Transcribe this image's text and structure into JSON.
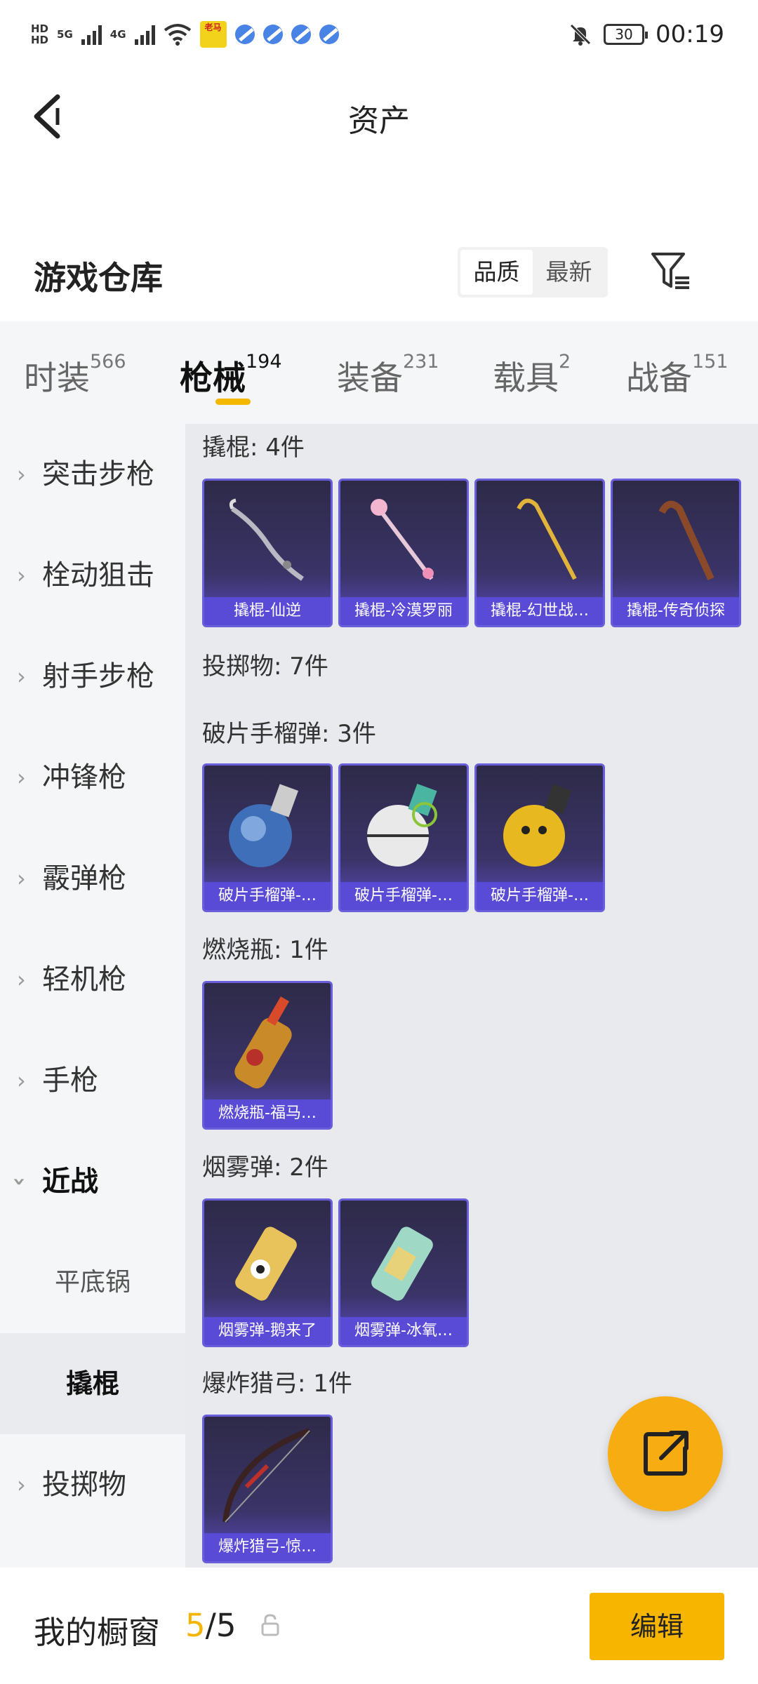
{
  "status_bar": {
    "hd1": "HD",
    "hd2": "HD",
    "net1": "5G",
    "net2": "4G",
    "app_label": "老马",
    "battery": "30",
    "time": "00:19"
  },
  "header": {
    "title": "资产"
  },
  "warehouse": {
    "title": "游戏仓库",
    "sort_options": [
      "品质",
      "最新"
    ]
  },
  "tabs": [
    {
      "label": "时装",
      "count": "566"
    },
    {
      "label": "枪械",
      "count": "194"
    },
    {
      "label": "装备",
      "count": "231"
    },
    {
      "label": "载具",
      "count": "2"
    },
    {
      "label": "战备",
      "count": "151"
    }
  ],
  "sidebar": {
    "items": [
      "突击步枪",
      "栓动狙击",
      "射手步枪",
      "冲锋枪",
      "霰弹枪",
      "轻机枪",
      "手枪",
      "近战",
      "投掷物"
    ],
    "sub_items": [
      "平底锅",
      "撬棍"
    ]
  },
  "sections": {
    "crowbar": {
      "title": "撬棍: 4件",
      "items": [
        "撬棍-仙逆",
        "撬棍-冷漠罗丽",
        "撬棍-幻世战…",
        "撬棍-传奇侦探"
      ]
    },
    "throwables": {
      "title": "投掷物: 7件"
    },
    "frag": {
      "title": "破片手榴弹: 3件",
      "items": [
        "破片手榴弹-…",
        "破片手榴弹-…",
        "破片手榴弹-…"
      ]
    },
    "molotov": {
      "title": "燃烧瓶: 1件",
      "items": [
        "燃烧瓶-福马…"
      ]
    },
    "smoke": {
      "title": "烟雾弹: 2件",
      "items": [
        "烟雾弹-鹅来了",
        "烟雾弹-冰氧…"
      ]
    },
    "bow": {
      "title": "爆炸猎弓: 1件",
      "items": [
        "爆炸猎弓-惊…"
      ]
    }
  },
  "bottom_bar": {
    "label": "我的橱窗",
    "count_current": "5",
    "count_sep": "/",
    "count_total": "5",
    "edit_label": "编辑"
  },
  "colors": {
    "accent": "#f7b500",
    "card_bg": "#3a3468",
    "card_caption": "#5a4bd6"
  }
}
